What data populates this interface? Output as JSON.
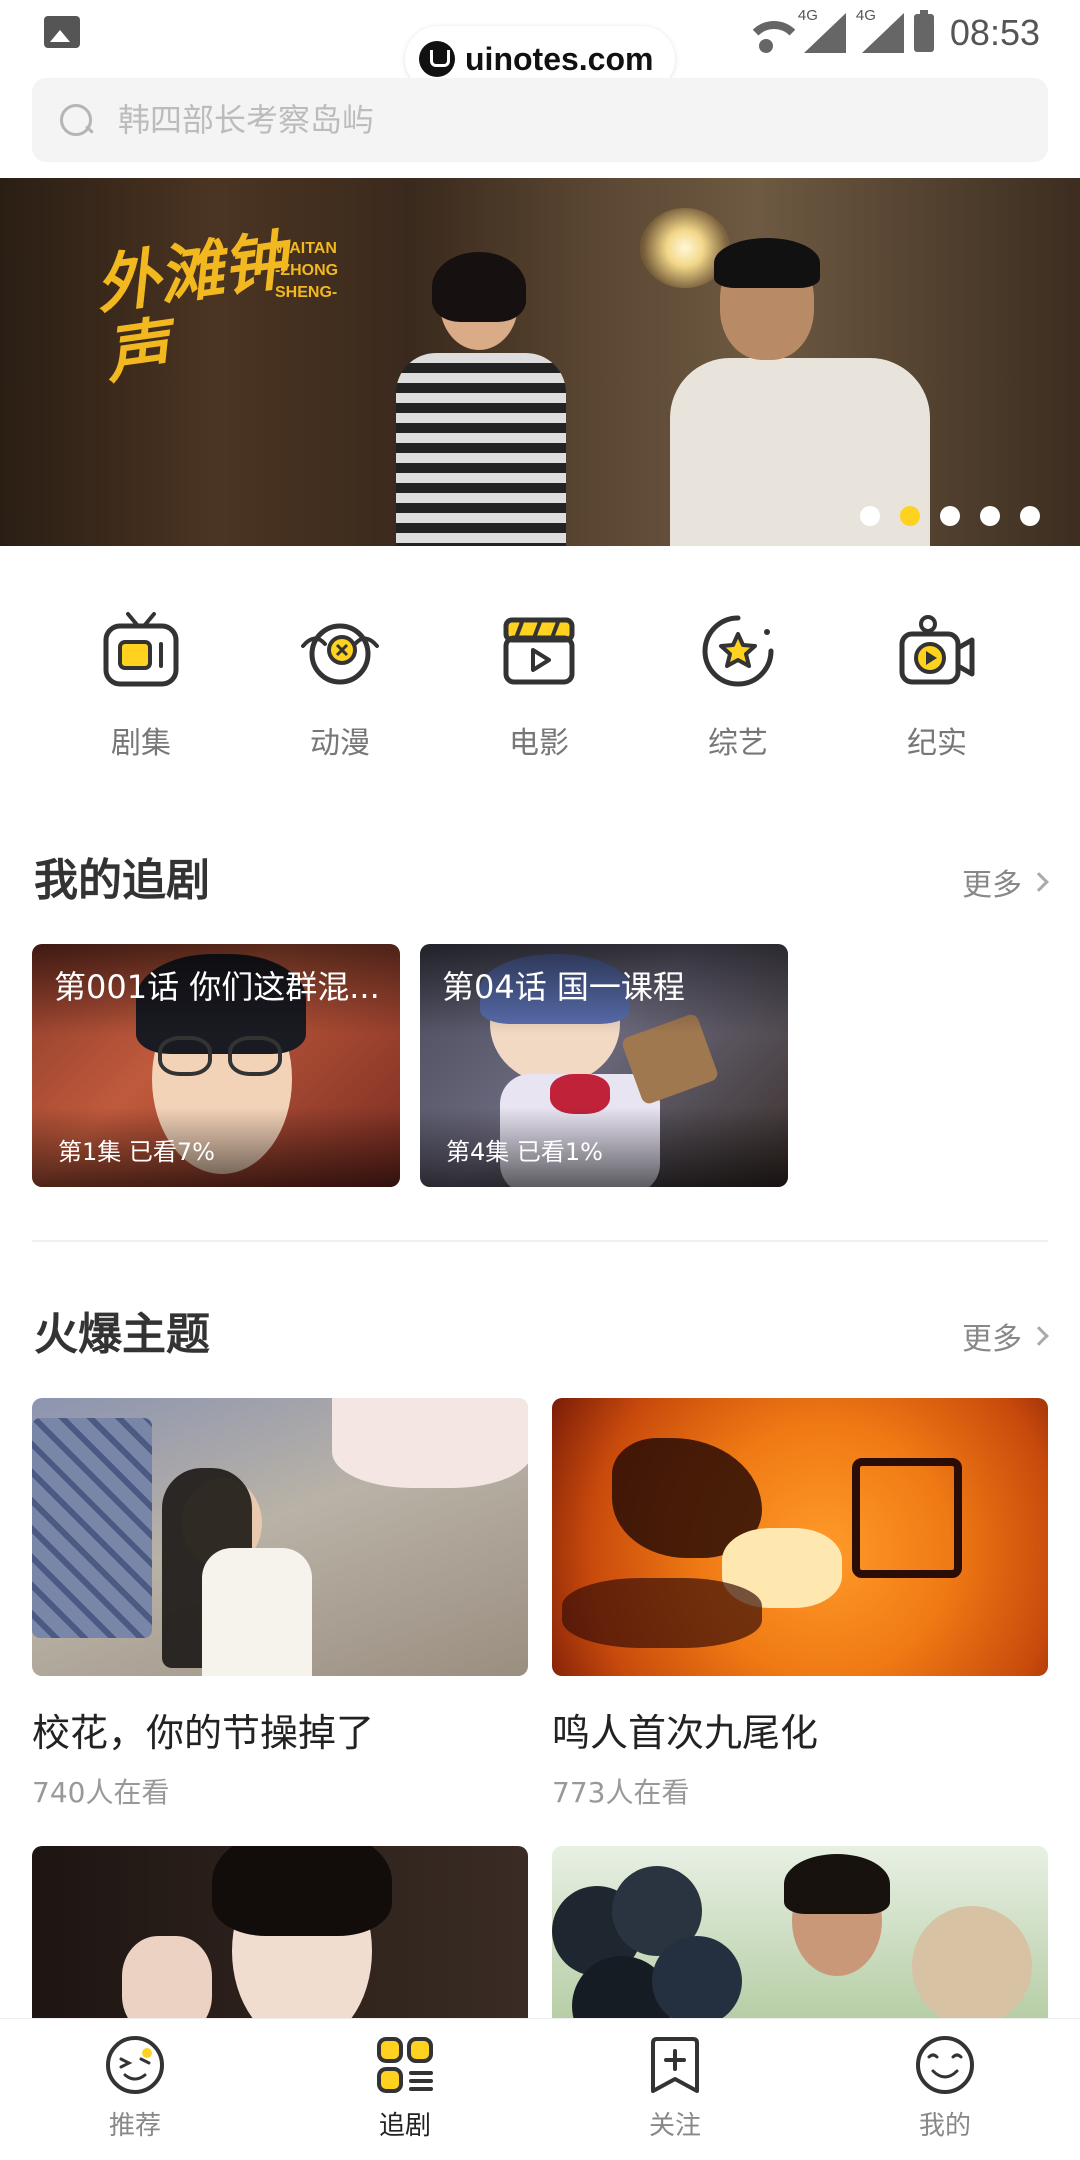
{
  "status_bar": {
    "watermark": "uinotes.com",
    "signal1_label": "4G",
    "signal2_label": "4G",
    "time": "08:53"
  },
  "search": {
    "placeholder": "韩四部长考察岛屿"
  },
  "banner": {
    "title_cn": "外滩钟声",
    "title_en": "WAITAN\n-ZHONG\nSHENG-",
    "slide_count": 5,
    "active_slide_index": 1
  },
  "categories": [
    {
      "label": "剧集",
      "icon": "tv-icon"
    },
    {
      "label": "动漫",
      "icon": "anime-icon"
    },
    {
      "label": "电影",
      "icon": "clapperboard-icon"
    },
    {
      "label": "综艺",
      "icon": "star-badge-icon"
    },
    {
      "label": "纪实",
      "icon": "documentary-camera-icon"
    }
  ],
  "my_following": {
    "title": "我的追剧",
    "more": "更多",
    "items": [
      {
        "title": "第001话 你们这群混...",
        "progress": "第1集  已看7%"
      },
      {
        "title": "第04话 国一课程",
        "progress": "第4集  已看1%"
      }
    ]
  },
  "hot_topics": {
    "title": "火爆主题",
    "more": "更多",
    "items": [
      {
        "name": "校花，你的节操掉了",
        "viewers": "740人在看"
      },
      {
        "name": "鸣人首次九尾化",
        "viewers": "773人在看"
      },
      {
        "name": "",
        "viewers": ""
      },
      {
        "name": "",
        "viewers": ""
      }
    ]
  },
  "tabbar": {
    "items": [
      {
        "label": "推荐",
        "icon": "recommend-face-icon"
      },
      {
        "label": "追剧",
        "icon": "grid-list-icon"
      },
      {
        "label": "关注",
        "icon": "bookmark-plus-icon"
      },
      {
        "label": "我的",
        "icon": "smiley-icon"
      }
    ],
    "active_index": 1
  },
  "colors": {
    "accent": "#ffd21f",
    "icon_stroke": "#333333"
  }
}
